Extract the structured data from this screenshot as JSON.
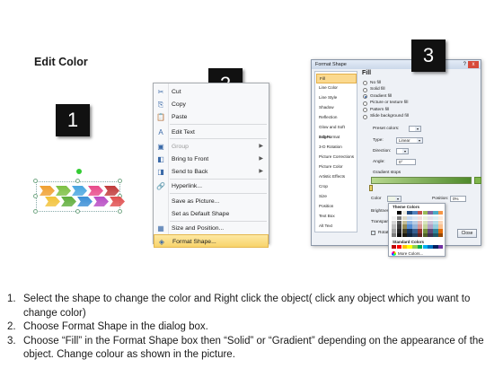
{
  "title": "Edit Color",
  "badges": [
    "1",
    "2",
    "3"
  ],
  "context_menu": {
    "items": [
      {
        "label": "Cut",
        "icon": "scissors-icon",
        "glyph": "✂",
        "disabled": false,
        "submenu": false
      },
      {
        "label": "Copy",
        "icon": "copy-icon",
        "glyph": "⎘",
        "disabled": false,
        "submenu": false
      },
      {
        "label": "Paste",
        "icon": "paste-icon",
        "glyph": "📋",
        "disabled": false,
        "submenu": false
      },
      {
        "label": "Edit Text",
        "icon": "edit-text-icon",
        "glyph": "A",
        "disabled": false,
        "submenu": false
      },
      {
        "label": "Group",
        "icon": "group-icon",
        "glyph": "▣",
        "disabled": true,
        "submenu": true
      },
      {
        "label": "Bring to Front",
        "icon": "bring-front-icon",
        "glyph": "◧",
        "disabled": false,
        "submenu": true
      },
      {
        "label": "Send to Back",
        "icon": "send-back-icon",
        "glyph": "◨",
        "disabled": false,
        "submenu": true
      },
      {
        "label": "Hyperlink...",
        "icon": "hyperlink-icon",
        "glyph": "🔗",
        "disabled": false,
        "submenu": false
      },
      {
        "label": "Save as Picture...",
        "icon": "",
        "glyph": "",
        "disabled": false,
        "submenu": false
      },
      {
        "label": "Set as Default Shape",
        "icon": "",
        "glyph": "",
        "disabled": false,
        "submenu": false
      },
      {
        "label": "Size and Position...",
        "icon": "size-position-icon",
        "glyph": "▦",
        "disabled": false,
        "submenu": false
      },
      {
        "label": "Format Shape...",
        "icon": "format-shape-icon",
        "glyph": "◈",
        "disabled": false,
        "submenu": false,
        "highlighted": true
      }
    ]
  },
  "dialog": {
    "title": "Format Shape",
    "help": "?",
    "close_x": "x",
    "nav": [
      "Fill",
      "Line Color",
      "Line Style",
      "Shadow",
      "Reflection",
      "Glow and Soft Edges",
      "3-D Format",
      "3-D Rotation",
      "Picture Corrections",
      "Picture Color",
      "Artistic Effects",
      "Crop",
      "Size",
      "Position",
      "Text Box",
      "Alt Text"
    ],
    "pane": {
      "heading": "Fill",
      "options": [
        "No fill",
        "Solid fill",
        "Gradient fill",
        "Picture or texture fill",
        "Pattern fill",
        "Slide background fill"
      ],
      "selected_option": 2,
      "preset_colors": "Preset colors:",
      "type_label": "Type:",
      "type_value": "Linear",
      "direction_label": "Direction:",
      "angle_label": "Angle:",
      "angle_value": "0°",
      "gradient_stops": "Gradient stops",
      "color_label": "Color",
      "position_label": "Position:",
      "position_value": "0%",
      "brightness_label": "Brightness:",
      "transparency_label": "Transparency:",
      "rotate_label": "Rotate w"
    },
    "close_button": "Close"
  },
  "palette": {
    "theme_label": "Theme Colors",
    "standard_label": "Standard Colors",
    "more_label": "More Colors...",
    "theme_colors": [
      "#ffffff",
      "#000000",
      "#eeece1",
      "#1f497d",
      "#4f81bd",
      "#c0504d",
      "#9bbb59",
      "#8064a2",
      "#4bacc6",
      "#f79646",
      "#f2f2f2",
      "#7f7f7f",
      "#ddd9c3",
      "#c6d9f0",
      "#dbe5f1",
      "#f2dcdb",
      "#ebf1dd",
      "#e5e0ec",
      "#dbeef3",
      "#fdeada",
      "#d8d8d8",
      "#595959",
      "#c4bd97",
      "#8db3e2",
      "#b8cce4",
      "#e5b9b7",
      "#d7e3bc",
      "#ccc1d9",
      "#b7dde8",
      "#fbd5b5",
      "#bfbfbf",
      "#3f3f3f",
      "#938953",
      "#548dd4",
      "#95b3d7",
      "#d99694",
      "#c3d69b",
      "#b2a2c7",
      "#92cddc",
      "#fac08f",
      "#a5a5a5",
      "#262626",
      "#494429",
      "#17365d",
      "#366092",
      "#953734",
      "#76923c",
      "#5f497a",
      "#31859b",
      "#e36c09",
      "#7f7f7f",
      "#0c0c0c",
      "#1d1b10",
      "#0f243e",
      "#244061",
      "#632423",
      "#4f6128",
      "#3f3151",
      "#205867",
      "#974806"
    ],
    "standard_colors": [
      "#c00000",
      "#ff0000",
      "#ffc000",
      "#ffff00",
      "#92d050",
      "#00b050",
      "#00b0f0",
      "#0070c0",
      "#002060",
      "#7030a0"
    ]
  },
  "shape": {
    "arrow_colors_row1": [
      "#f0a030",
      "#7cc043",
      "#4aa6e0",
      "#e84a8a",
      "#c03a3a"
    ],
    "arrow_colors_row2": [
      "#f2c23a",
      "#5fae3b",
      "#3b8fd6",
      "#b84bc4",
      "#e05050"
    ]
  },
  "instructions": [
    {
      "num": "1.",
      "text": "Select the shape to change the color and Right click the object( click any object which you want to change color)"
    },
    {
      "num": "2.",
      "text": "Choose Format Shape in the dialog box."
    },
    {
      "num": "3.",
      "text": "Choose “Fill” in the Format Shape box then “Solid” or “Gradient” depending on the appearance of the object. Change colour as shown in the picture."
    }
  ]
}
